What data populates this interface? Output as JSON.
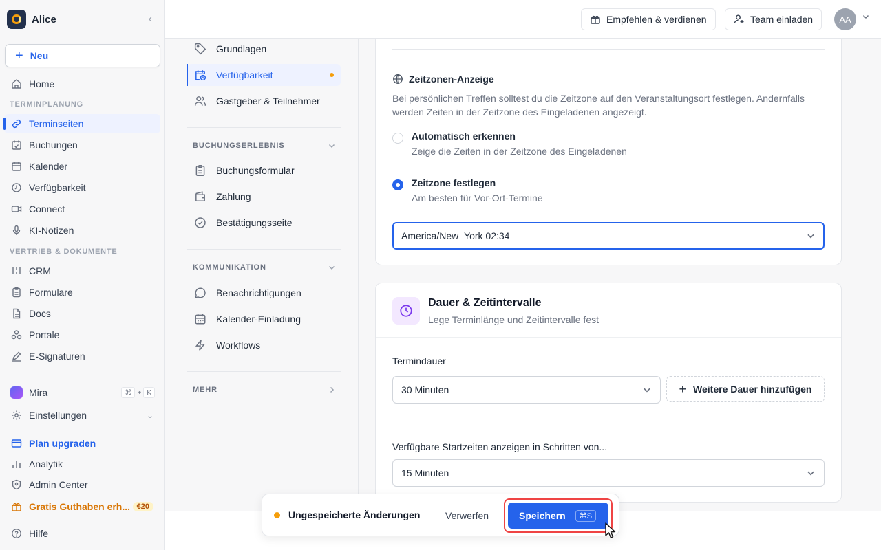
{
  "workspace": {
    "name": "Alice"
  },
  "sidebar": {
    "new_label": "Neu",
    "home": "Home",
    "section1": "TERMINPLANUNG",
    "items1": [
      {
        "label": "Terminseiten",
        "icon": "link-icon"
      },
      {
        "label": "Buchungen",
        "icon": "calendar-check-icon"
      },
      {
        "label": "Kalender",
        "icon": "calendar-icon"
      },
      {
        "label": "Verfügbarkeit",
        "icon": "clock-icon"
      },
      {
        "label": "Connect",
        "icon": "video-icon"
      },
      {
        "label": "KI-Notizen",
        "icon": "microphone-icon"
      }
    ],
    "section2": "VERTRIEB & DOKUMENTE",
    "items2": [
      {
        "label": "CRM",
        "icon": "crm-icon"
      },
      {
        "label": "Formulare",
        "icon": "clipboard-icon"
      },
      {
        "label": "Docs",
        "icon": "document-icon"
      },
      {
        "label": "Portale",
        "icon": "portal-icon"
      },
      {
        "label": "E-Signaturen",
        "icon": "pen-icon"
      }
    ],
    "mira": "Mira",
    "mira_kbd": [
      "⌘",
      "+",
      "K"
    ],
    "einstellungen": "Einstellungen",
    "plan_upgraden": "Plan upgraden",
    "analytik": "Analytik",
    "admin_center": "Admin Center",
    "gratis": "Gratis Guthaben erh...",
    "gratis_badge": "€20",
    "hilfe": "Hilfe"
  },
  "topbar": {
    "refer": "Empfehlen & verdienen",
    "invite": "Team einladen",
    "avatar": "AA"
  },
  "settings_nav": {
    "items_top": [
      {
        "label": "Grundlagen",
        "icon": "tag-icon"
      },
      {
        "label": "Verfügbarkeit",
        "icon": "calendar-clock-icon"
      },
      {
        "label": "Gastgeber & Teilnehmer",
        "icon": "users-icon"
      }
    ],
    "section_booking": "BUCHUNGSERLEBNIS",
    "items_booking": [
      {
        "label": "Buchungsformular",
        "icon": "clipboard-icon"
      },
      {
        "label": "Zahlung",
        "icon": "wallet-icon"
      },
      {
        "label": "Bestätigungsseite",
        "icon": "check-circle-icon"
      }
    ],
    "section_comm": "KOMMUNIKATION",
    "items_comm": [
      {
        "label": "Benachrichtigungen",
        "icon": "chat-icon"
      },
      {
        "label": "Kalender-Einladung",
        "icon": "calendar-icon"
      },
      {
        "label": "Workflows",
        "icon": "bolt-icon"
      }
    ],
    "section_more": "MEHR"
  },
  "timezone": {
    "heading": "Zeitzonen-Anzeige",
    "description": "Bei persönlichen Treffen solltest du die Zeitzone auf den Veranstaltungsort festlegen. Andernfalls werden Zeiten in der Zeitzone des Eingeladenen angezeigt.",
    "option_auto_title": "Automatisch erkennen",
    "option_auto_sub": "Zeige die Zeiten in der Zeitzone des Eingeladenen",
    "option_fixed_title": "Zeitzone festlegen",
    "option_fixed_sub": "Am besten für Vor-Ort-Termine",
    "selected_option": "fixed",
    "select_value": "America/New_York 02:34"
  },
  "duration": {
    "title": "Dauer & Zeitintervalle",
    "subtitle": "Lege Terminlänge und Zeitintervalle fest",
    "label_duration": "Termindauer",
    "duration_value": "30 Minuten",
    "add_duration": "Weitere Dauer hinzufügen",
    "label_interval": "Verfügbare Startzeiten anzeigen in Schritten von...",
    "interval_value": "15 Minuten"
  },
  "savebar": {
    "unsaved": "Ungespeicherte Änderungen",
    "discard": "Verwerfen",
    "save": "Speichern",
    "save_kbd": "⌘S"
  },
  "colors": {
    "accent": "#2563eb",
    "warning": "#f59e0b",
    "highlight": "#ef4444"
  }
}
